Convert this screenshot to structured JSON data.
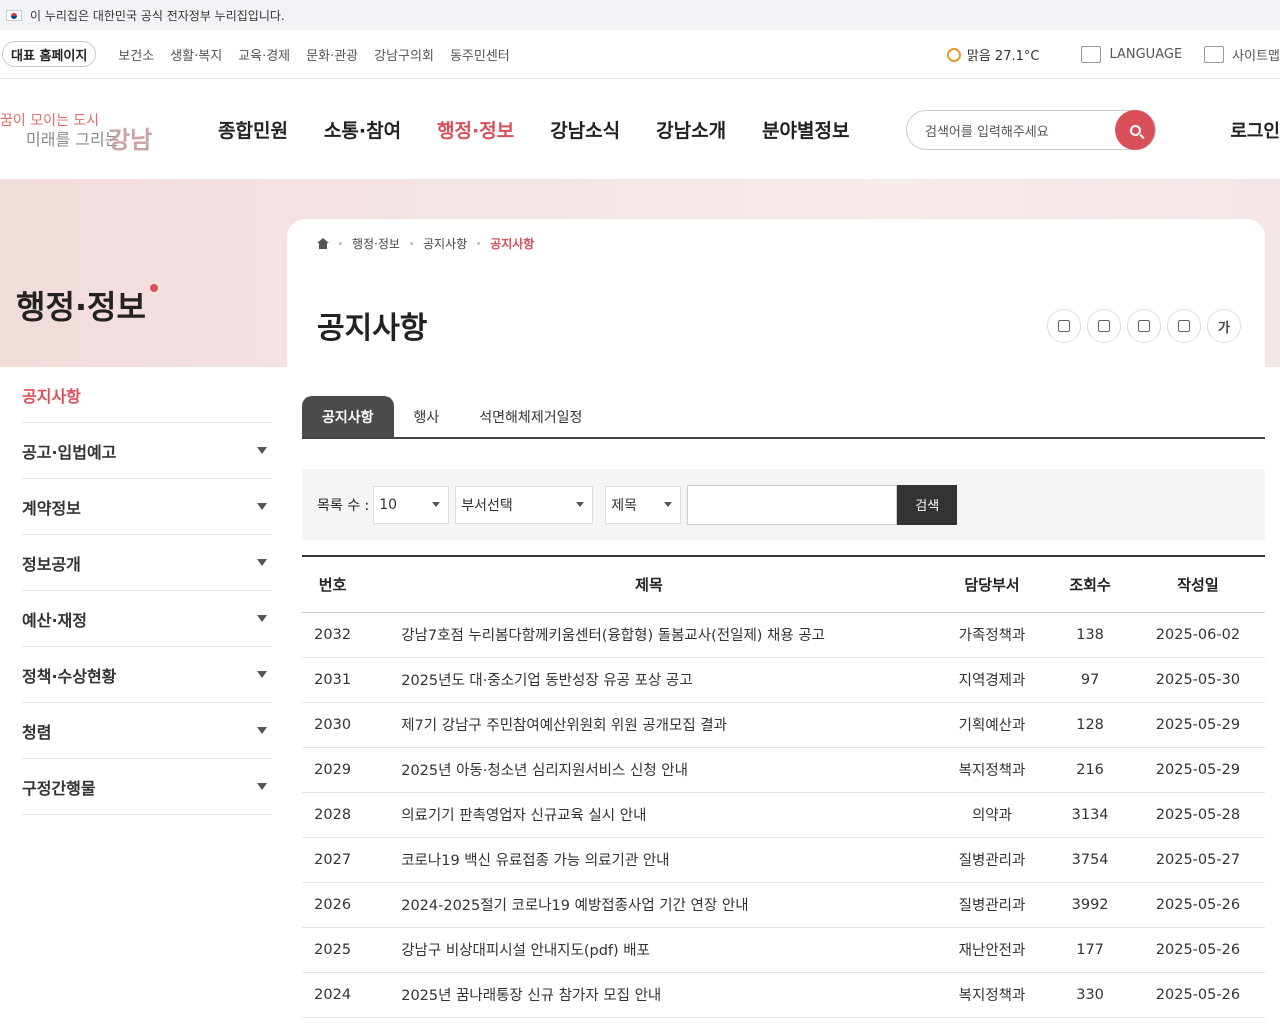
{
  "gov_banner": {
    "text": "이 누리집은 대한민국 공식 전자정부 누리집입니다."
  },
  "util": {
    "home_label": "대표 홈페이지",
    "links": [
      "보건소",
      "생활·복지",
      "교육·경제",
      "문화·관광",
      "강남구의회",
      "동주민센터"
    ],
    "weather": "맑음  27.1°C",
    "language": "LANGUAGE",
    "sitemap": "사이트맵"
  },
  "logo": {
    "line1": "꿈이 모이는 도시",
    "line2": "미래를 그리는",
    "line3": "강남"
  },
  "gnb": [
    "종합민원",
    "소통·참여",
    "행정·정보",
    "강남소식",
    "강남소개",
    "분야별정보"
  ],
  "gnb_active": 2,
  "search": {
    "placeholder": "검색어를 입력해주세요"
  },
  "login": "로그인",
  "section_title": "행정·정보",
  "breadcrumb": [
    "행정·정보",
    "공지사항",
    "공지사항"
  ],
  "page_title": "공지사항",
  "tools": [
    {
      "icon": "share-icon",
      "label": ""
    },
    {
      "icon": "print-icon",
      "label": ""
    },
    {
      "icon": "qr-icon",
      "label": ""
    },
    {
      "icon": "download-icon",
      "label": ""
    },
    {
      "icon": "font-size-icon",
      "label": "가"
    }
  ],
  "lnb": [
    "공지사항",
    "공고·입법예고",
    "계약정보",
    "정보공개",
    "예산·재정",
    "정책·수상현황",
    "청렴",
    "구정간행물"
  ],
  "tabs": [
    "공지사항",
    "행사",
    "석면해체제거일정"
  ],
  "filter": {
    "count_label": "목록 수 :",
    "count_value": "10",
    "dept_value": "부서선택",
    "field_value": "제목",
    "search_button": "검색"
  },
  "table": {
    "headers": [
      "번호",
      "제목",
      "담당부서",
      "조회수",
      "작성일"
    ],
    "rows": [
      [
        "2032",
        "강남7호점 누리봄다함께키움센터(융합형) 돌봄교사(전일제) 채용 공고",
        "가족정책과",
        "138",
        "2025-06-02"
      ],
      [
        "2031",
        "2025년도 대·중소기업 동반성장 유공 포상 공고",
        "지역경제과",
        "97",
        "2025-05-30"
      ],
      [
        "2030",
        "제7기 강남구 주민참여예산위원회 위원 공개모집 결과",
        "기획예산과",
        "128",
        "2025-05-29"
      ],
      [
        "2029",
        "2025년 아동·청소년 심리지원서비스 신청 안내",
        "복지정책과",
        "216",
        "2025-05-29"
      ],
      [
        "2028",
        "의료기기 판촉영업자 신규교육 실시 안내",
        "의약과",
        "3134",
        "2025-05-28"
      ],
      [
        "2027",
        "코로나19 백신 유료접종 가능 의료기관 안내",
        "질병관리과",
        "3754",
        "2025-05-27"
      ],
      [
        "2026",
        "2024-2025절기 코로나19 예방접종사업 기간 연장 안내",
        "질병관리과",
        "3992",
        "2025-05-26"
      ],
      [
        "2025",
        "강남구 비상대피시설 안내지도(pdf) 배포",
        "재난안전과",
        "177",
        "2025-05-26"
      ],
      [
        "2024",
        "2025년 꿈나래통장 신규 참가자 모집 안내",
        "복지정책과",
        "330",
        "2025-05-26"
      ]
    ]
  }
}
